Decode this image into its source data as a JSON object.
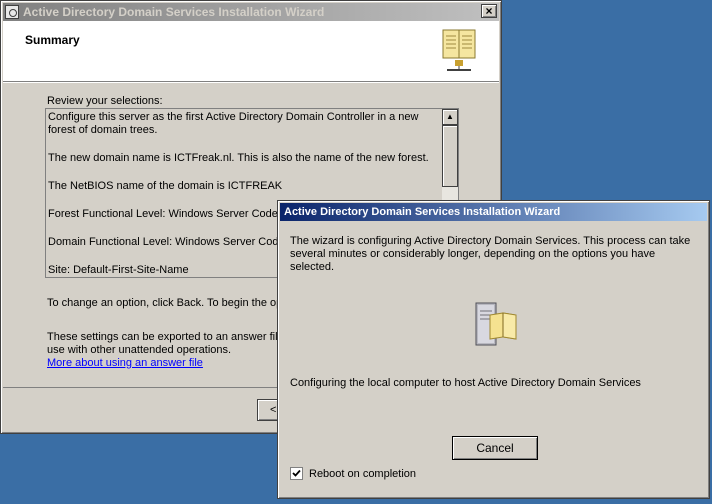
{
  "main_window": {
    "title": "Active Directory Domain Services Installation Wizard",
    "close_glyph": "×",
    "header_title": "Summary",
    "review_label": "Review your selections:",
    "summary_lines": [
      "Configure this server as the first Active Directory Domain Controller in a new forest of domain trees.",
      "The new domain name is ICTFreak.nl. This is also the name of the new forest.",
      "The NetBIOS name of the domain is ICTFREAK",
      "Forest Functional Level: Windows Server Codename \"Longhorn\"",
      "Domain Functional Level: Windows Server Codename \"Longhorn\"",
      "Site: Default-First-Site-Name"
    ],
    "change_text": "To change an option, click Back. To begin the operation, click Next.",
    "export_text": "These settings can be exported to an answer file for use with other unattended operations.",
    "link_text": "More about using an answer file",
    "back_button_label": "< Back",
    "icons": [
      "window-system-icon",
      "book-network-icon",
      "scroll-up-icon"
    ]
  },
  "progress_dialog": {
    "title": "Active Directory Domain Services Installation Wizard",
    "description": "The wizard is configuring Active Directory Domain Services. This process can take several minutes or considerably longer, depending on the options you have selected.",
    "status": "Configuring the local computer to host Active Directory Domain Services",
    "cancel_label": "Cancel",
    "reboot_label": "Reboot on completion",
    "reboot_checked": true,
    "icons": [
      "domain-controller-book-icon",
      "checkmark-icon"
    ]
  },
  "colors": {
    "desktop": "#3a6ea5",
    "active_title": "#0a246a",
    "inactive_title": "#808080",
    "face": "#d4d0c8",
    "link": "#0000ff"
  }
}
